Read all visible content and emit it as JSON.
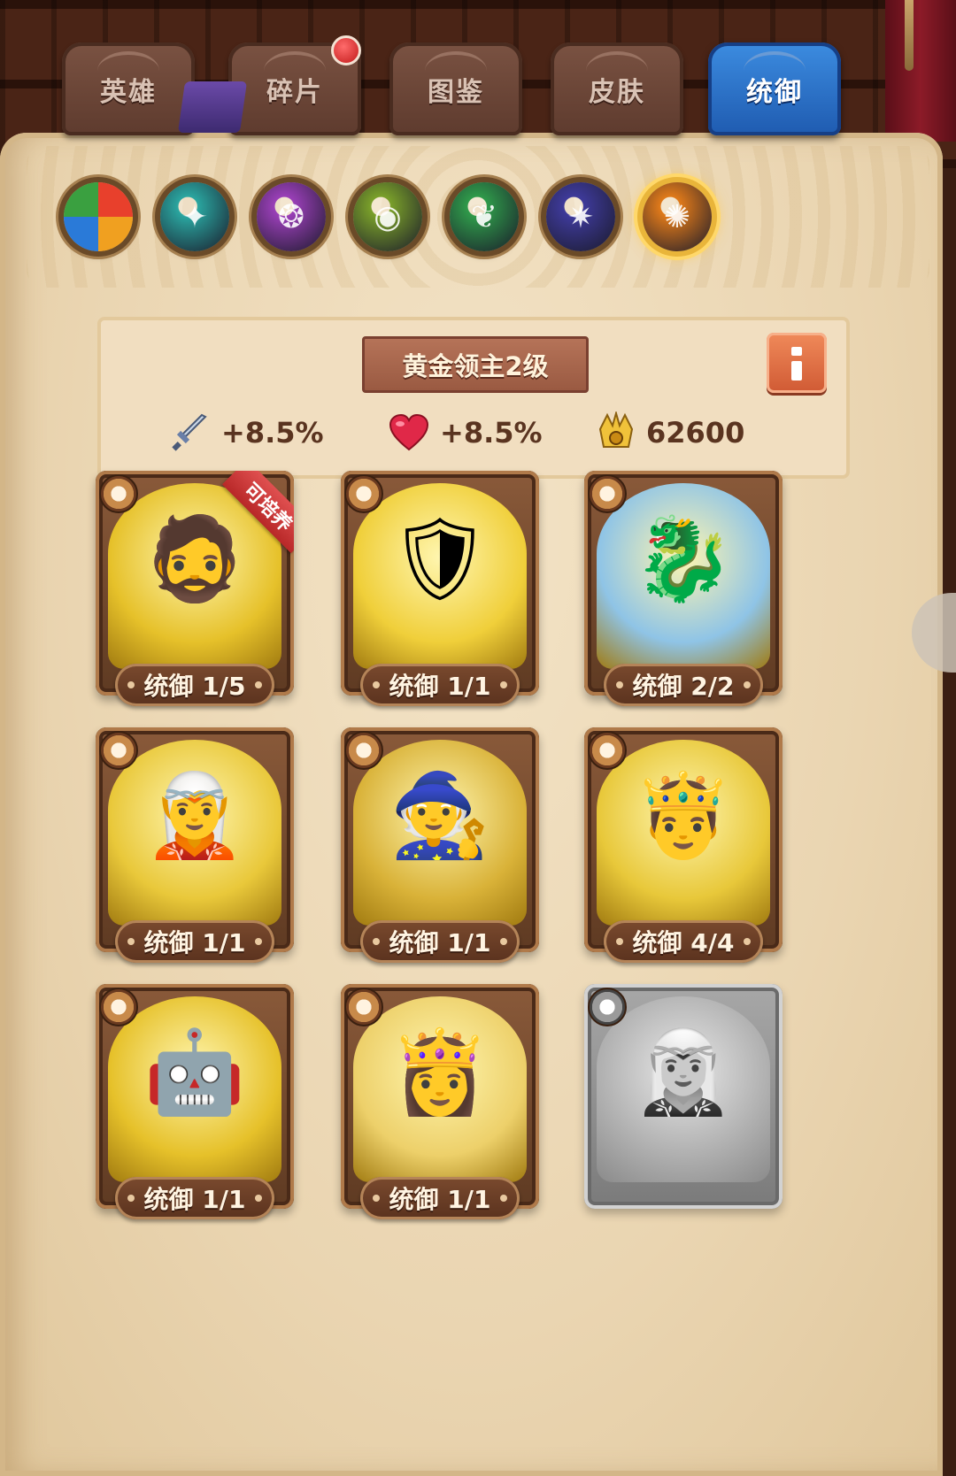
{
  "tabs": [
    {
      "label": "英雄",
      "active": false,
      "badge": false
    },
    {
      "label": "碎片",
      "active": false,
      "badge": true
    },
    {
      "label": "图鉴",
      "active": false,
      "badge": false
    },
    {
      "label": "皮肤",
      "active": false,
      "badge": false
    },
    {
      "label": "统御",
      "active": true,
      "badge": false
    }
  ],
  "factions": [
    {
      "icon": "all-factions-icon",
      "color": "#e8402c",
      "active": false
    },
    {
      "icon": "forest-faction-icon",
      "color": "#2aa6a0",
      "active": false
    },
    {
      "icon": "shadow-faction-icon",
      "color": "#9a3fb8",
      "active": false
    },
    {
      "icon": "fortress-faction-icon",
      "color": "#7aa02a",
      "active": false
    },
    {
      "icon": "abyss-faction-icon",
      "color": "#2f9a4a",
      "active": false
    },
    {
      "icon": "dark-faction-icon",
      "color": "#3e3a9a",
      "active": false
    },
    {
      "icon": "light-faction-icon",
      "color": "#e07a1a",
      "active": true
    }
  ],
  "info": {
    "title": "黄金领主2级",
    "attack_bonus": "+8.5%",
    "hp_bonus": "+8.5%",
    "power": "62600"
  },
  "cards": [
    {
      "level": "统御 1/5",
      "ribbon": "可培养",
      "greyed": false,
      "glyph": "🧔",
      "bg": "#e6c12a"
    },
    {
      "level": "统御 1/1",
      "ribbon": "",
      "greyed": false,
      "glyph": "🛡",
      "bg": "#f0cf3a"
    },
    {
      "level": "统御 2/2",
      "ribbon": "",
      "greyed": false,
      "glyph": "🐉",
      "bg": "#8fc4e6"
    },
    {
      "level": "统御 1/1",
      "ribbon": "",
      "greyed": false,
      "glyph": "🧝",
      "bg": "#e9c83a"
    },
    {
      "level": "统御 1/1",
      "ribbon": "",
      "greyed": false,
      "glyph": "🧙",
      "bg": "#d9b238"
    },
    {
      "level": "统御 4/4",
      "ribbon": "",
      "greyed": false,
      "glyph": "🤴",
      "bg": "#e8c83a"
    },
    {
      "level": "统御 1/1",
      "ribbon": "",
      "greyed": false,
      "glyph": "🤖",
      "bg": "#e6c12a"
    },
    {
      "level": "统御 1/1",
      "ribbon": "",
      "greyed": false,
      "glyph": "👸",
      "bg": "#edd06a"
    },
    {
      "level": "",
      "ribbon": "",
      "greyed": true,
      "glyph": "🧝‍♀️",
      "bg": "#9a9a9a"
    }
  ]
}
